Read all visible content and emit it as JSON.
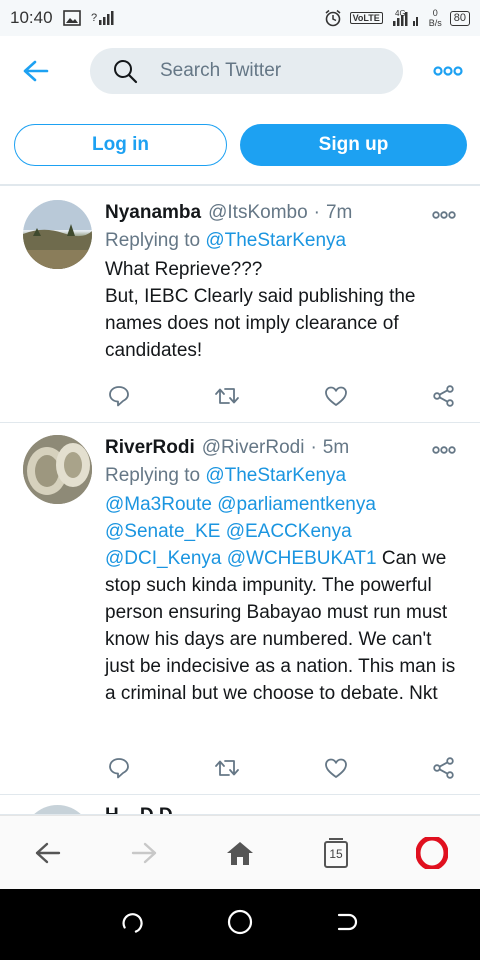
{
  "status_bar": {
    "time": "10:40",
    "signal_label": "?",
    "volte": "VoLTE",
    "network": "4G",
    "speed_value": "0",
    "speed_unit": "B/s",
    "battery": "80"
  },
  "top_bar": {
    "search_placeholder": "Search Twitter"
  },
  "auth": {
    "login_label": "Log in",
    "signup_label": "Sign up"
  },
  "tweets": [
    {
      "name": "Nyanamba",
      "handle": "@ItsKombo",
      "time": "7m",
      "replying_prefix": "Replying to",
      "replying_to": "@TheStarKenya",
      "text": "What Reprieve???\nBut, IEBC Clearly said publishing the names does not imply clearance of candidates!"
    },
    {
      "name": "RiverRodi",
      "handle": "@RiverRodi",
      "time": "5m",
      "replying_prefix": "Replying to",
      "replying_to": "@TheStarKenya",
      "mentions": "@Ma3Route @parliamentkenya @Senate_KE @EACCKenya @DCI_Kenya @WCHEBUKAT1",
      "text": " Can we stop such kinda impunity. The powerful person ensuring Babayao must run must know his days are numbered. We can't just be indecisive as a nation. This man is a criminal but we choose to debate. Nkt"
    },
    {
      "name_partial": "H... D.D..."
    }
  ],
  "bottom_nav": {
    "tab_count": "15"
  },
  "colors": {
    "accent": "#1da1f2",
    "link": "#1b95e0",
    "muted": "#657786",
    "opera_red": "#e0101f"
  }
}
